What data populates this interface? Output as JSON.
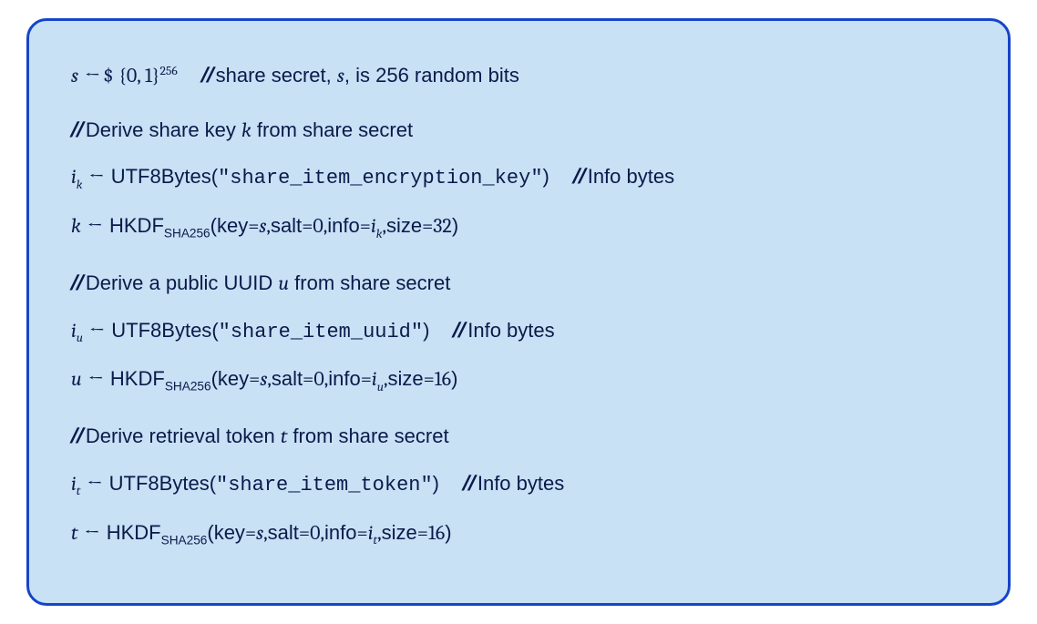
{
  "line1": {
    "var": "s",
    "set": "{0, 1}",
    "exp": "256",
    "comment_a": "share secret, ",
    "comment_var": "s",
    "comment_b": ", is 256 random bits"
  },
  "section_k": {
    "heading": "Derive share key ",
    "heading_var": "k",
    "heading_tail": " from share secret",
    "info_lhs_base": "i",
    "info_lhs_sub": "k",
    "info_fn": "UTF8Bytes",
    "info_arg": "\"share_item_encryption_key\"",
    "info_comment": "Info bytes",
    "derive_lhs": "k",
    "derive_fn": "HKDF",
    "derive_fn_sub": "SHA256",
    "key_lbl": "key",
    "key_eq": " = ",
    "key_val": "s",
    "salt_lbl": "salt",
    "salt_val": "0",
    "info_lbl": "info",
    "info_val_base": "i",
    "info_val_sub": "k",
    "size_lbl": "size",
    "size_val": "32"
  },
  "section_u": {
    "heading": "Derive a public UUID ",
    "heading_var": "u",
    "heading_tail": " from share secret",
    "info_lhs_base": "i",
    "info_lhs_sub": "u",
    "info_fn": "UTF8Bytes",
    "info_arg": "\"share_item_uuid\"",
    "info_comment": "Info bytes",
    "derive_lhs": "u",
    "derive_fn": "HKDF",
    "derive_fn_sub": "SHA256",
    "key_lbl": "key",
    "key_val": "s",
    "salt_lbl": "salt",
    "salt_val": "0",
    "info_lbl": "info",
    "info_val_base": "i",
    "info_val_sub": "u",
    "size_lbl": "size",
    "size_val": "16"
  },
  "section_t": {
    "heading": "Derive retrieval token ",
    "heading_var": "t",
    "heading_tail": " from share secret",
    "info_lhs_base": "i",
    "info_lhs_sub": "t",
    "info_fn": "UTF8Bytes",
    "info_arg": "\"share_item_token\"",
    "info_comment": "Info bytes",
    "derive_lhs": "t",
    "derive_fn": "HKDF",
    "derive_fn_sub": "SHA256",
    "key_lbl": "key",
    "key_val": "s",
    "salt_lbl": "salt",
    "salt_val": "0",
    "info_lbl": "info",
    "info_val_base": "i",
    "info_val_sub": "t",
    "size_lbl": "size",
    "size_val": "16"
  },
  "sym": {
    "slash": "//",
    "arrow": "←",
    "dollar": "$",
    "comma": ", ",
    "eq": " = ",
    "open": "(",
    "close": ")"
  }
}
